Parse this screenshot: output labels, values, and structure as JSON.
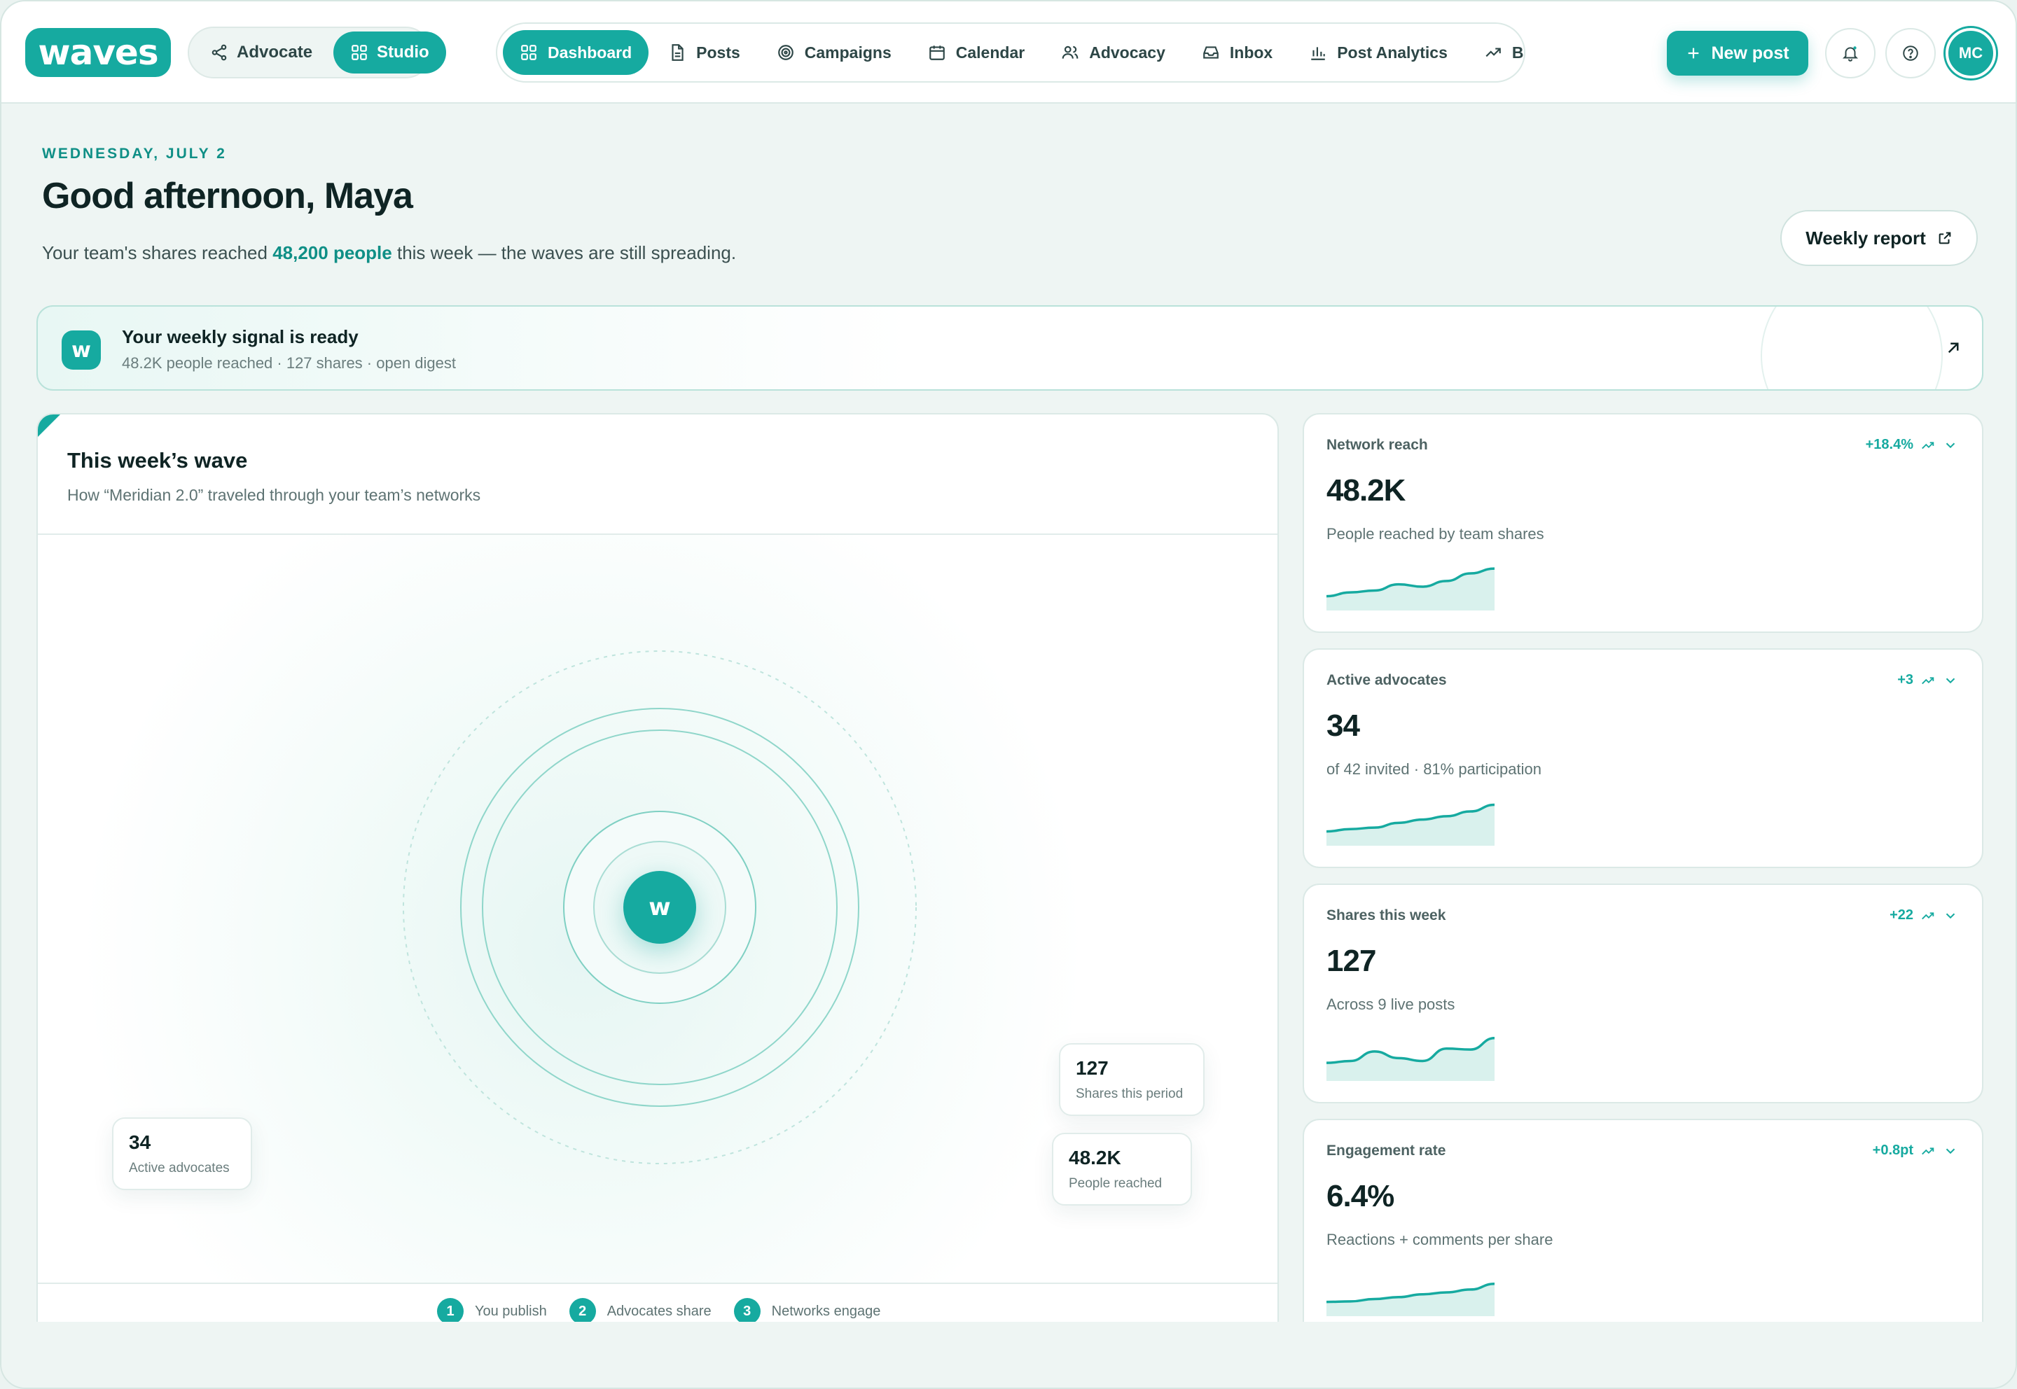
{
  "brand": {
    "logo_text": "waves",
    "accent": "#16aaa0"
  },
  "modes": [
    {
      "label": "Advocate",
      "icon": "share-icon",
      "active": false
    },
    {
      "label": "Studio",
      "icon": "grid-icon",
      "active": true
    }
  ],
  "nav": [
    {
      "label": "Dashboard",
      "icon": "grid-icon",
      "active": true
    },
    {
      "label": "Posts",
      "icon": "document-icon"
    },
    {
      "label": "Campaigns",
      "icon": "target-icon"
    },
    {
      "label": "Calendar",
      "icon": "calendar-icon"
    },
    {
      "label": "Advocacy",
      "icon": "users-icon"
    },
    {
      "label": "Inbox",
      "icon": "inbox-icon"
    },
    {
      "label": "Post Analytics",
      "icon": "bar-chart-icon"
    },
    {
      "label": "Brar",
      "icon": "trend-icon"
    }
  ],
  "actions": {
    "new_post": "New post",
    "avatar_initials": "MC"
  },
  "header": {
    "date": "WEDNESDAY, JULY 2",
    "greeting": "Good afternoon, Maya",
    "summary_prefix": "Your team's shares reached ",
    "summary_highlight": "48,200 people",
    "summary_suffix": " this week — the waves are still spreading.",
    "weekly_report": "Weekly report"
  },
  "signal": {
    "icon_letter": "w",
    "title": "Your weekly signal is ready",
    "subtitle": "48.2K people reached · 127 shares · open digest"
  },
  "wave": {
    "title": "This week’s wave",
    "subtitle": "How “Meridian 2.0” traveled through your team’s networks",
    "hub_letter": "w",
    "stats": [
      {
        "value": "127",
        "label": "Shares this period"
      },
      {
        "value": "34",
        "label": "Active advocates"
      },
      {
        "value": "48.2K",
        "label": "People reached"
      }
    ],
    "steps": [
      {
        "num": "1",
        "label": "You publish"
      },
      {
        "num": "2",
        "label": "Advocates share"
      },
      {
        "num": "3",
        "label": "Networks engage"
      }
    ]
  },
  "metrics": [
    {
      "label": "Network reach",
      "delta": "+18.4%",
      "value": "48.2K",
      "desc": "People reached by team shares",
      "trend": [
        0.3,
        0.38,
        0.42,
        0.55,
        0.5,
        0.62,
        0.78,
        0.88
      ]
    },
    {
      "label": "Active advocates",
      "delta": "+3",
      "value": "34",
      "desc": "of 42 invited · 81% participation",
      "trend": [
        0.3,
        0.35,
        0.38,
        0.48,
        0.55,
        0.62,
        0.72,
        0.86
      ]
    },
    {
      "label": "Shares this week",
      "delta": "+22",
      "value": "127",
      "desc": "Across 9 live posts",
      "trend": [
        0.38,
        0.42,
        0.62,
        0.48,
        0.42,
        0.68,
        0.66,
        0.9
      ]
    },
    {
      "label": "Engagement rate",
      "delta": "+0.8pt",
      "value": "6.4%",
      "desc": "Reactions + comments per share",
      "trend": [
        0.3,
        0.31,
        0.36,
        0.4,
        0.46,
        0.5,
        0.56,
        0.68
      ]
    }
  ]
}
